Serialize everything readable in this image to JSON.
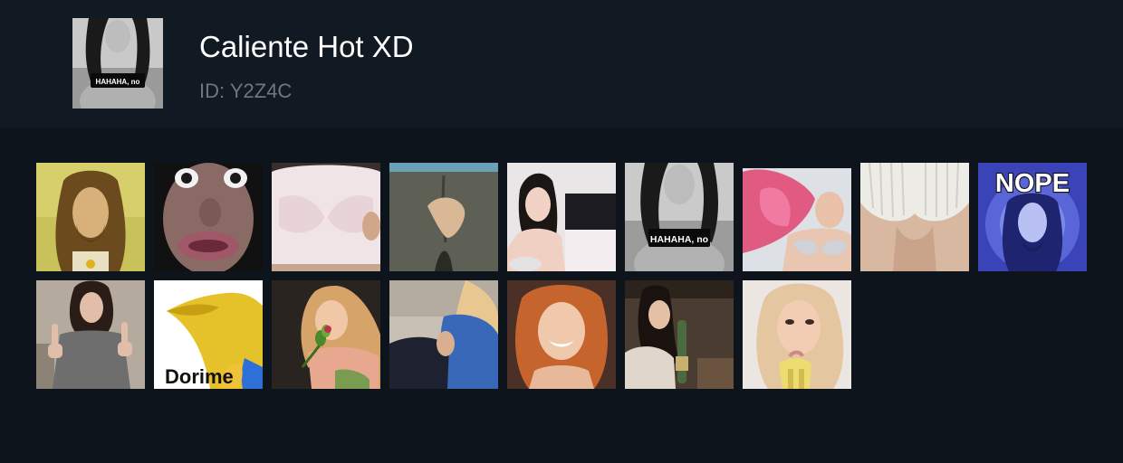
{
  "pack": {
    "title": "Caliente Hot XD",
    "id_label": "ID:",
    "id_value": "Y2Z4C",
    "thumbnail_caption": "HAHAHA, no"
  },
  "stickers": [
    {
      "name": "sticker-portrait-gold",
      "caption": ""
    },
    {
      "name": "sticker-funny-face",
      "caption": ""
    },
    {
      "name": "sticker-pink-shirt",
      "caption": ""
    },
    {
      "name": "sticker-grey-leggings",
      "caption": ""
    },
    {
      "name": "sticker-selfie-room",
      "caption": ""
    },
    {
      "name": "sticker-hahaha-no",
      "caption": "HAHAHA, no"
    },
    {
      "name": "sticker-pink-hair",
      "caption": ""
    },
    {
      "name": "sticker-white-sweater",
      "caption": ""
    },
    {
      "name": "sticker-nope-portrait",
      "caption": "NOPE"
    },
    {
      "name": "sticker-middle-fingers",
      "caption": ""
    },
    {
      "name": "sticker-dorime-cat",
      "caption": "Dorime"
    },
    {
      "name": "sticker-rose",
      "caption": ""
    },
    {
      "name": "sticker-blue-shirt",
      "caption": ""
    },
    {
      "name": "sticker-smiling-redhead",
      "caption": ""
    },
    {
      "name": "sticker-bottle",
      "caption": ""
    },
    {
      "name": "sticker-banana",
      "caption": ""
    }
  ],
  "colors": {
    "page_bg": "#0e141c",
    "header_bg": "#111922",
    "title": "#ffffff",
    "id_text": "#6e767f"
  }
}
